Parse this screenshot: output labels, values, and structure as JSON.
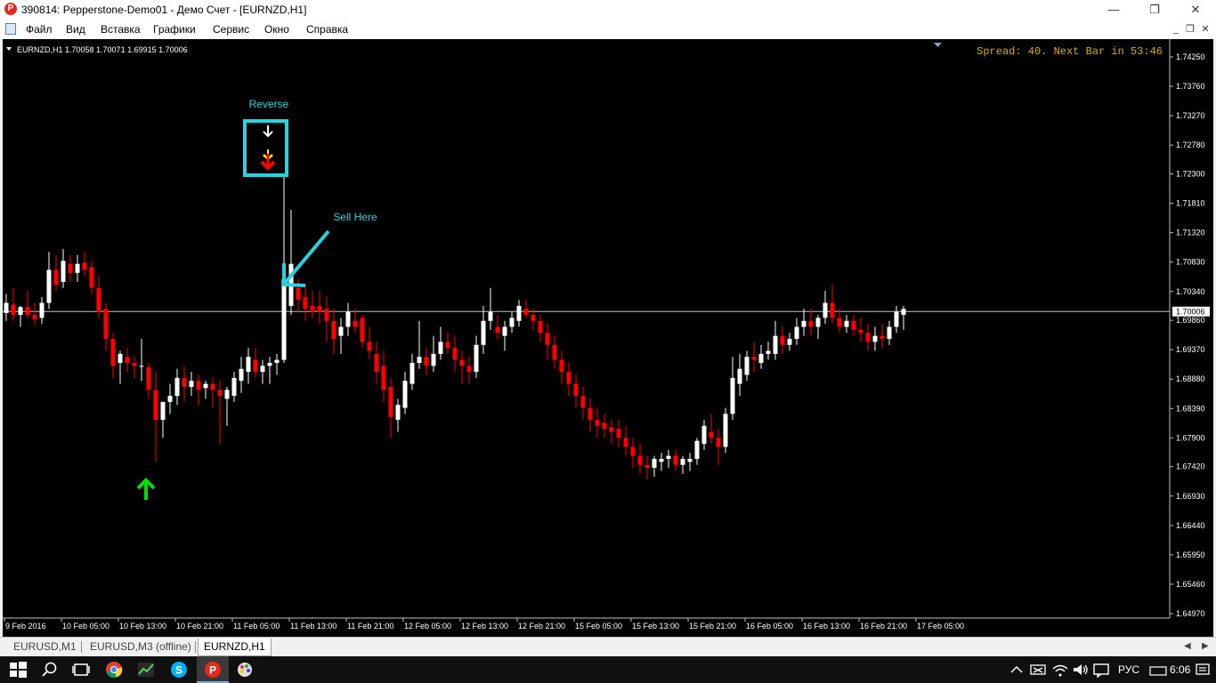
{
  "window": {
    "title": "390814: Pepperstone-Demo01 - Демо Счет - [EURNZD,H1]",
    "app_icon_letter": "P",
    "minimize_glyph": "—",
    "maximize_glyph": "❐",
    "close_glyph": "✕"
  },
  "menu": {
    "items": [
      "Файл",
      "Вид",
      "Вставка",
      "Графики",
      "Сервис",
      "Окно",
      "Справка"
    ],
    "mdi_minimize": "_",
    "mdi_restore": "❐",
    "mdi_close": "✕"
  },
  "chart": {
    "symbol_header": "EURNZD,H1  1.70058 1.70071 1.69915 1.70006",
    "info_text": "Spread: 40. Next Bar in 53:46",
    "current_price": "1.70006",
    "annotation_reverse": "Reverse",
    "annotation_sell": "Sell Here",
    "colors": {
      "background": "#000000",
      "bull": "#ffffff",
      "bear": "#ff0000",
      "grid_text": "#ffffff",
      "info_text": "#d4b000",
      "annotation": "#27d3e0",
      "buy_arrow": "#00e000"
    }
  },
  "chart_data": {
    "type": "candlestick",
    "symbol": "EURNZD",
    "timeframe": "H1",
    "yticks": [
      "1.74250",
      "1.73760",
      "1.73270",
      "1.72780",
      "1.72300",
      "1.71810",
      "1.71320",
      "1.70830",
      "1.70340",
      "1.69860",
      "1.69370",
      "1.68880",
      "1.68390",
      "1.67900",
      "1.67420",
      "1.66930",
      "1.66440",
      "1.65950",
      "1.65460",
      "1.64970"
    ],
    "xticks": [
      "9 Feb 2016",
      "10 Feb 05:00",
      "10 Feb 13:00",
      "10 Feb 21:00",
      "11 Feb 05:00",
      "11 Feb 13:00",
      "11 Feb 21:00",
      "12 Feb 05:00",
      "12 Feb 13:00",
      "12 Feb 21:00",
      "15 Feb 05:00",
      "15 Feb 13:00",
      "15 Feb 21:00",
      "16 Feb 05:00",
      "16 Feb 13:00",
      "16 Feb 21:00",
      "17 Feb 05:00"
    ],
    "ylim": [
      1.6497,
      1.7425
    ],
    "current_price": 1.70006,
    "candles": [
      [
        1.6998,
        1.703,
        1.6985,
        1.7015
      ],
      [
        1.7012,
        1.704,
        1.6985,
        1.6995
      ],
      [
        1.6995,
        1.701,
        1.6975,
        1.7008
      ],
      [
        1.7008,
        1.7035,
        1.699,
        1.6995
      ],
      [
        1.6995,
        1.7015,
        1.6978,
        1.6988
      ],
      [
        1.699,
        1.7025,
        1.698,
        1.7015
      ],
      [
        1.7015,
        1.71,
        1.7005,
        1.707
      ],
      [
        1.707,
        1.7095,
        1.7035,
        1.7045
      ],
      [
        1.705,
        1.7105,
        1.704,
        1.7085
      ],
      [
        1.708,
        1.7095,
        1.705,
        1.7065
      ],
      [
        1.7065,
        1.7095,
        1.705,
        1.708
      ],
      [
        1.7082,
        1.71,
        1.706,
        1.707
      ],
      [
        1.7075,
        1.7085,
        1.703,
        1.704
      ],
      [
        1.704,
        1.706,
        1.699,
        1.7
      ],
      [
        1.7005,
        1.7015,
        1.6935,
        1.6955
      ],
      [
        1.6955,
        1.6965,
        1.689,
        1.691
      ],
      [
        1.6915,
        1.6935,
        1.688,
        1.693
      ],
      [
        1.6925,
        1.694,
        1.69,
        1.6915
      ],
      [
        1.6915,
        1.6925,
        1.689,
        1.691
      ],
      [
        1.691,
        1.6955,
        1.6885,
        1.691
      ],
      [
        1.6908,
        1.6915,
        1.6855,
        1.687
      ],
      [
        1.687,
        1.69,
        1.675,
        1.682
      ],
      [
        1.682,
        1.685,
        1.679,
        1.685
      ],
      [
        1.685,
        1.688,
        1.683,
        1.686
      ],
      [
        1.686,
        1.6905,
        1.6845,
        1.689
      ],
      [
        1.689,
        1.691,
        1.685,
        1.6875
      ],
      [
        1.6875,
        1.69,
        1.686,
        1.6885
      ],
      [
        1.6885,
        1.6895,
        1.6845,
        1.687
      ],
      [
        1.6873,
        1.6885,
        1.6855,
        1.688
      ],
      [
        1.688,
        1.689,
        1.684,
        1.687
      ],
      [
        1.687,
        1.6885,
        1.678,
        1.686
      ],
      [
        1.6855,
        1.6875,
        1.681,
        1.687
      ],
      [
        1.686,
        1.69,
        1.685,
        1.689
      ],
      [
        1.6885,
        1.6925,
        1.6865,
        1.6905
      ],
      [
        1.69,
        1.694,
        1.688,
        1.6925
      ],
      [
        1.692,
        1.694,
        1.689,
        1.69
      ],
      [
        1.69,
        1.692,
        1.688,
        1.691
      ],
      [
        1.691,
        1.6925,
        1.688,
        1.6915
      ],
      [
        1.6915,
        1.693,
        1.6895,
        1.692
      ],
      [
        1.692,
        1.7225,
        1.6915,
        1.7055
      ],
      [
        1.701,
        1.717,
        1.6995,
        1.708
      ],
      [
        1.704,
        1.7055,
        1.7,
        1.702
      ],
      [
        1.7025,
        1.7045,
        1.6985,
        1.7005
      ],
      [
        1.701,
        1.7035,
        1.699,
        1.7
      ],
      [
        1.701,
        1.7035,
        1.698,
        1.7
      ],
      [
        1.7005,
        1.7025,
        1.695,
        1.6985
      ],
      [
        1.6985,
        1.7005,
        1.693,
        1.6955
      ],
      [
        1.696,
        1.699,
        1.693,
        1.6975
      ],
      [
        1.6975,
        1.7015,
        1.696,
        1.7
      ],
      [
        1.6985,
        1.7005,
        1.6965,
        1.6975
      ],
      [
        1.699,
        1.6995,
        1.694,
        1.695
      ],
      [
        1.695,
        1.6975,
        1.692,
        1.6935
      ],
      [
        1.693,
        1.695,
        1.688,
        1.69
      ],
      [
        1.691,
        1.6935,
        1.685,
        1.687
      ],
      [
        1.6875,
        1.689,
        1.679,
        1.6825
      ],
      [
        1.682,
        1.6855,
        1.68,
        1.6845
      ],
      [
        1.684,
        1.69,
        1.683,
        1.6885
      ],
      [
        1.688,
        1.693,
        1.687,
        1.6915
      ],
      [
        1.6915,
        1.6985,
        1.6905,
        1.6925
      ],
      [
        1.6925,
        1.694,
        1.6895,
        1.691
      ],
      [
        1.691,
        1.696,
        1.69,
        1.693
      ],
      [
        1.693,
        1.6975,
        1.692,
        1.695
      ],
      [
        1.695,
        1.6965,
        1.693,
        1.694
      ],
      [
        1.694,
        1.696,
        1.69,
        1.692
      ],
      [
        1.692,
        1.6935,
        1.688,
        1.691
      ],
      [
        1.691,
        1.6925,
        1.688,
        1.69
      ],
      [
        1.69,
        1.696,
        1.689,
        1.6945
      ],
      [
        1.6945,
        1.701,
        1.693,
        1.6985
      ],
      [
        1.6985,
        1.704,
        1.697,
        1.7
      ],
      [
        1.6975,
        1.6995,
        1.6955,
        1.6965
      ],
      [
        1.696,
        1.6985,
        1.6935,
        1.6975
      ],
      [
        1.6975,
        1.7,
        1.6965,
        1.699
      ],
      [
        1.6985,
        1.702,
        1.6975,
        1.701
      ],
      [
        1.7005,
        1.702,
        1.699,
        1.6995
      ],
      [
        1.6995,
        1.7005,
        1.697,
        1.6985
      ],
      [
        1.6985,
        1.6995,
        1.695,
        1.6965
      ],
      [
        1.6965,
        1.698,
        1.692,
        1.6945
      ],
      [
        1.6945,
        1.696,
        1.6905,
        1.692
      ],
      [
        1.692,
        1.6935,
        1.688,
        1.69
      ],
      [
        1.69,
        1.6915,
        1.686,
        1.688
      ],
      [
        1.688,
        1.6895,
        1.684,
        1.686
      ],
      [
        1.686,
        1.6875,
        1.682,
        1.684
      ],
      [
        1.684,
        1.6855,
        1.68,
        1.682
      ],
      [
        1.682,
        1.684,
        1.679,
        1.681
      ],
      [
        1.6815,
        1.683,
        1.679,
        1.6805
      ],
      [
        1.6808,
        1.682,
        1.678,
        1.68
      ],
      [
        1.6805,
        1.682,
        1.6775,
        1.679
      ],
      [
        1.679,
        1.681,
        1.676,
        1.6775
      ],
      [
        1.6775,
        1.679,
        1.674,
        1.676
      ],
      [
        1.676,
        1.678,
        1.673,
        1.6745
      ],
      [
        1.6745,
        1.676,
        1.672,
        1.674
      ],
      [
        1.674,
        1.676,
        1.6725,
        1.6755
      ],
      [
        1.675,
        1.6765,
        1.6735,
        1.6755
      ],
      [
        1.6755,
        1.677,
        1.674,
        1.676
      ],
      [
        1.676,
        1.677,
        1.6735,
        1.6745
      ],
      [
        1.6745,
        1.676,
        1.673,
        1.6755
      ],
      [
        1.675,
        1.6765,
        1.6735,
        1.6755
      ],
      [
        1.6755,
        1.679,
        1.6745,
        1.6785
      ],
      [
        1.678,
        1.682,
        1.677,
        1.681
      ],
      [
        1.68,
        1.683,
        1.678,
        1.679
      ],
      [
        1.679,
        1.6805,
        1.6745,
        1.6775
      ],
      [
        1.6775,
        1.684,
        1.6765,
        1.683
      ],
      [
        1.683,
        1.6925,
        1.682,
        1.689
      ],
      [
        1.688,
        1.693,
        1.686,
        1.6905
      ],
      [
        1.6895,
        1.6935,
        1.6885,
        1.6925
      ],
      [
        1.6925,
        1.695,
        1.69,
        1.692
      ],
      [
        1.6915,
        1.6945,
        1.6905,
        1.693
      ],
      [
        1.693,
        1.695,
        1.692,
        1.6935
      ],
      [
        1.693,
        1.6985,
        1.692,
        1.696
      ],
      [
        1.696,
        1.6975,
        1.693,
        1.6945
      ],
      [
        1.6945,
        1.6965,
        1.6935,
        1.6955
      ],
      [
        1.6955,
        1.699,
        1.6945,
        1.6975
      ],
      [
        1.6975,
        1.7005,
        1.696,
        1.6985
      ],
      [
        1.6985,
        1.7005,
        1.696,
        1.6975
      ],
      [
        1.6975,
        1.6995,
        1.6955,
        1.699
      ],
      [
        1.699,
        1.7035,
        1.698,
        1.7015
      ],
      [
        1.7015,
        1.7045,
        1.698,
        1.699
      ],
      [
        1.699,
        1.7005,
        1.6965,
        1.6975
      ],
      [
        1.6975,
        1.6995,
        1.6965,
        1.6985
      ],
      [
        1.6985,
        1.6995,
        1.696,
        1.697
      ],
      [
        1.697,
        1.699,
        1.695,
        1.6965
      ],
      [
        1.6965,
        1.698,
        1.6935,
        1.695
      ],
      [
        1.695,
        1.6975,
        1.6935,
        1.696
      ],
      [
        1.696,
        1.698,
        1.694,
        1.6955
      ],
      [
        1.6955,
        1.6985,
        1.6945,
        1.6975
      ],
      [
        1.6975,
        1.701,
        1.6965,
        1.7
      ],
      [
        1.6995,
        1.701,
        1.697,
        1.7005
      ]
    ]
  },
  "tabs": [
    "EURUSD,M1",
    "EURUSD,M3 (offline)",
    "EURNZD,H1"
  ],
  "taskbar": {
    "language": "РУС",
    "clock": "6:06"
  }
}
